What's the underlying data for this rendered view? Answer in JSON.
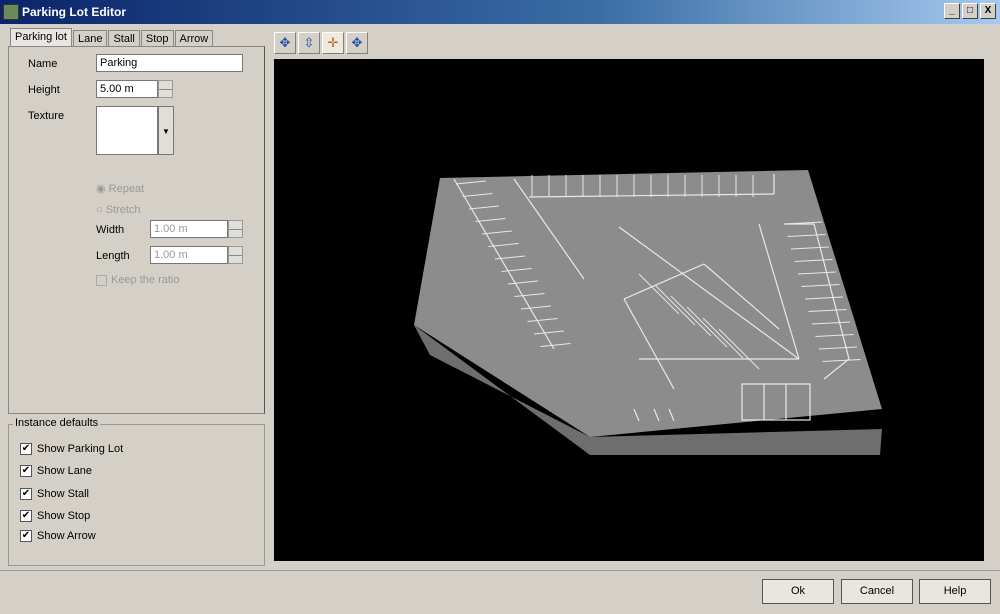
{
  "window": {
    "title": "Parking Lot Editor",
    "controls": [
      "_",
      "□",
      "X"
    ]
  },
  "tabs": [
    "Parking lot",
    "Lane",
    "Stall",
    "Stop",
    "Arrow"
  ],
  "form": {
    "name_label": "Name",
    "name_value": "Parking",
    "height_label": "Height",
    "height_value": "5.00 m",
    "texture_label": "Texture",
    "repeat_label": "Repeat",
    "stretch_label": "Stretch",
    "width_label": "Width",
    "width_value": "1.00 m",
    "length_label": "Length",
    "length_value": "1.00 m",
    "keep_ratio_label": "Keep the ratio"
  },
  "instance_defaults": {
    "title": "Instance defaults",
    "items": [
      {
        "label": "Show Parking Lot",
        "checked": true
      },
      {
        "label": "Show Lane",
        "checked": true
      },
      {
        "label": "Show Stall",
        "checked": true
      },
      {
        "label": "Show Stop",
        "checked": true
      },
      {
        "label": "Show Arrow",
        "checked": true
      }
    ]
  },
  "toolbar": {
    "icons": [
      "rotate-icon",
      "move-vertical-icon",
      "pan-icon",
      "zoom-icon"
    ],
    "glyphs": [
      "✥",
      "⇳",
      "✛",
      "✥"
    ]
  },
  "buttons": {
    "ok": "Ok",
    "cancel": "Cancel",
    "help": "Help"
  }
}
